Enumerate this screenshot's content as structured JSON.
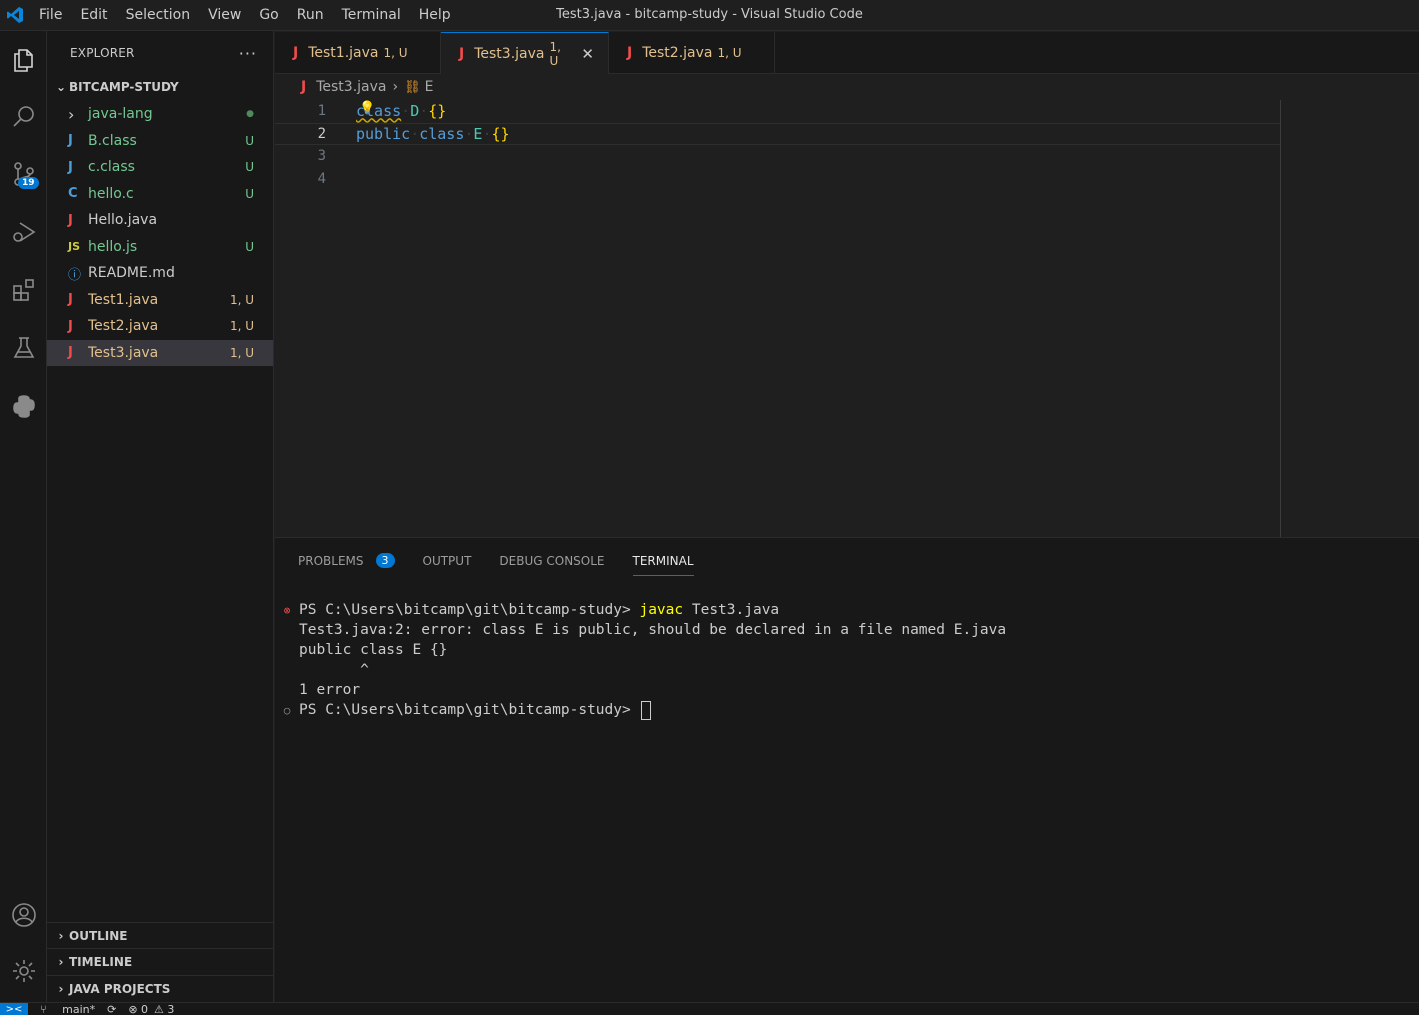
{
  "window": {
    "title": "Test3.java - bitcamp-study - Visual Studio Code"
  },
  "menu": [
    "File",
    "Edit",
    "Selection",
    "View",
    "Go",
    "Run",
    "Terminal",
    "Help"
  ],
  "activity_bar": {
    "source_control_badge": "19"
  },
  "explorer": {
    "header": "EXPLORER",
    "more": "···",
    "section": "BITCAMP-STUDY",
    "files": [
      {
        "icon": "›",
        "name": "java-lang",
        "status": "●",
        "type": "folder"
      },
      {
        "icon": "J",
        "name": "B.class",
        "status": "U",
        "type": "class"
      },
      {
        "icon": "J",
        "name": "c.class",
        "status": "U",
        "type": "class"
      },
      {
        "icon": "C",
        "name": "hello.c",
        "status": "U",
        "type": "c"
      },
      {
        "icon": "J",
        "name": "Hello.java",
        "status": "",
        "type": "java"
      },
      {
        "icon": "JS",
        "name": "hello.js",
        "status": "U",
        "type": "js"
      },
      {
        "icon": "ⓘ",
        "name": "README.md",
        "status": "",
        "type": "md"
      },
      {
        "icon": "J",
        "name": "Test1.java",
        "status": "1, U",
        "type": "java-err"
      },
      {
        "icon": "J",
        "name": "Test2.java",
        "status": "1, U",
        "type": "java-err"
      },
      {
        "icon": "J",
        "name": "Test3.java",
        "status": "1, U",
        "type": "java-err"
      }
    ],
    "bottom_sections": [
      "OUTLINE",
      "TIMELINE",
      "JAVA PROJECTS"
    ]
  },
  "tabs": [
    {
      "icon": "J",
      "name": "Test1.java",
      "status": "1, U"
    },
    {
      "icon": "J",
      "name": "Test3.java",
      "status": "1, U",
      "close": "✕"
    },
    {
      "icon": "J",
      "name": "Test2.java",
      "status": "1, U"
    }
  ],
  "breadcrumb": {
    "file": "Test3.java",
    "separator": "›",
    "symbol": "E"
  },
  "code": {
    "line_numbers": [
      "1",
      "2",
      "3",
      "4"
    ],
    "line1": {
      "kw": "class",
      "name": "D",
      "braces": "{}"
    },
    "line2": {
      "kw1": "public",
      "kw2": "class",
      "name": "E",
      "braces": "{}"
    }
  },
  "panel": {
    "tabs": [
      "PROBLEMS",
      "OUTPUT",
      "DEBUG CONSOLE",
      "TERMINAL"
    ],
    "problems_count": "3",
    "terminal": {
      "line1_prompt": "PS C:\\Users\\bitcamp\\git\\bitcamp-study> ",
      "line1_cmd": "javac",
      "line1_args": " Test3.java",
      "line2": "Test3.java:2: error: class E is public, should be declared in a file named E.java",
      "line3": "public class E {}",
      "line4": "       ^",
      "line5": "1 error",
      "line6_prompt": "PS C:\\Users\\bitcamp\\git\\bitcamp-study> "
    }
  },
  "status_bar": {
    "remote": "><",
    "branch": "main*",
    "sync": "⟳",
    "errors": "⊗ 0",
    "warnings": "⚠ 3"
  }
}
